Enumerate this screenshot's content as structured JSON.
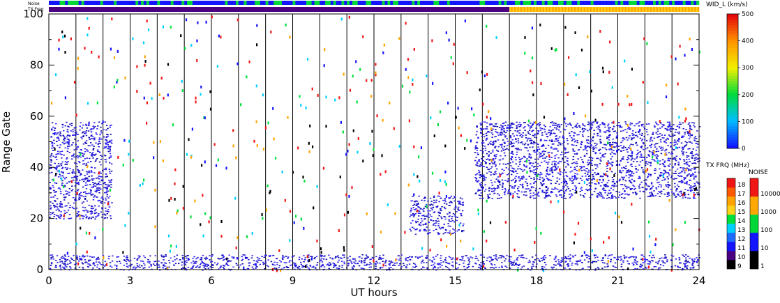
{
  "chart_data": {
    "type": "heatmap",
    "xlabel": "UT hours",
    "ylabel": "Range Gate",
    "xlim": [
      0,
      24
    ],
    "ylim": [
      0,
      100
    ],
    "x_ticks": [
      "0",
      "3",
      "6",
      "9",
      "12",
      "15",
      "18",
      "21",
      "24"
    ],
    "y_ticks": [
      "0",
      "20",
      "40",
      "60",
      "80",
      "100"
    ],
    "strip_labels": {
      "noise": "Noise",
      "txfreq": "TX Freq"
    },
    "scatter_regions": [
      {
        "name": "early-echo-band",
        "x": [
          0,
          2.3
        ],
        "gate": [
          20,
          58
        ],
        "color": "#2a1fe6"
      },
      {
        "name": "midday-echo-patch",
        "x": [
          13.3,
          15.3
        ],
        "gate": [
          14,
          29
        ],
        "color": "#2a1fe6"
      },
      {
        "name": "late-echo-band",
        "x": [
          15.7,
          24
        ],
        "gate": [
          28,
          58
        ],
        "color": "#2a1fe6"
      },
      {
        "name": "near-range-echo",
        "x": [
          0,
          24
        ],
        "gate": [
          0,
          6
        ],
        "color": "#2a1fe6"
      }
    ],
    "colorbar_main": {
      "title": "WID_L (km/s)",
      "min": 0,
      "max": 500,
      "ticks": [
        "0",
        "100",
        "200",
        "300",
        "400",
        "500"
      ]
    },
    "colorbar_freq": {
      "title": "TX FRQ (MHz)",
      "ticks": [
        "9",
        "10",
        "11",
        "12",
        "13",
        "14",
        "15",
        "16",
        "17",
        "18"
      ],
      "colors": [
        "#000000",
        "#4b0082",
        "#1414ff",
        "#1e6cff",
        "#00d0ff",
        "#00e03a",
        "#ffd21a",
        "#ffa400",
        "#ff5a00",
        "#f01616"
      ]
    },
    "colorbar_noise": {
      "title": "NOISE",
      "ticks": [
        "1",
        "10",
        "100",
        "1000",
        "10000"
      ],
      "colors": [
        "#000000",
        "#1414ff",
        "#00d83a",
        "#ffa800",
        "#f01616"
      ]
    }
  }
}
